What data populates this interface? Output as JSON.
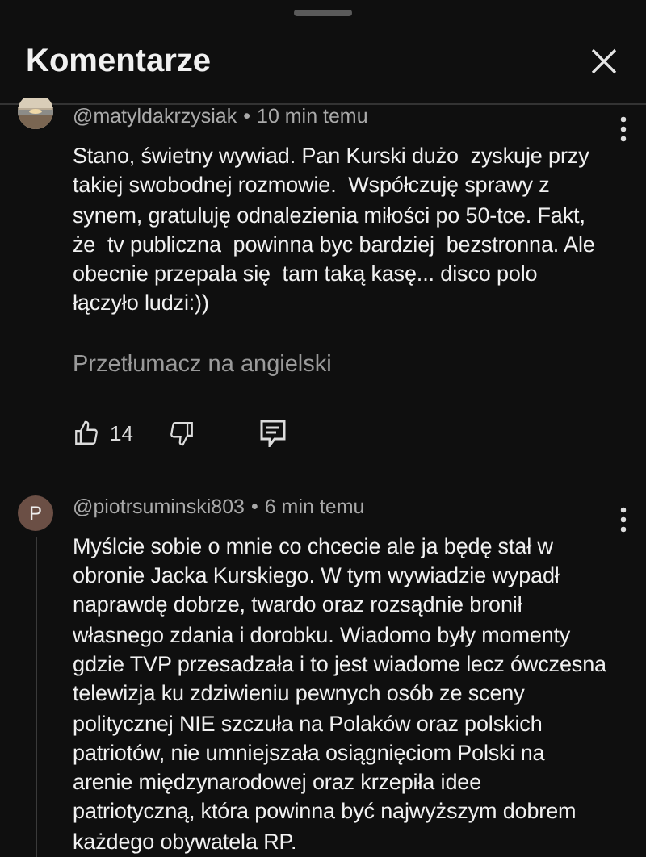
{
  "sheet": {
    "title": "Komentarze"
  },
  "comments": [
    {
      "author": "@matyldakrzysiak",
      "separator": "•",
      "time": "10 min temu",
      "text": "Stano, świetny wywiad. Pan Kurski dużo  zyskuje przy takiej swobodnej rozmowie.  Współczuję sprawy z synem, gratuluję odnalezienia miłości po 50-tce. Fakt, że  tv publiczna  powinna byc bardziej  bezstronna. Ale obecnie przepala się  tam taką kasę... disco polo łączyło ludzi:))",
      "translate": "Przetłumacz na angielski",
      "likes": "14"
    },
    {
      "avatar": {
        "kind": "letter",
        "letter": "P"
      },
      "author": "@piotrsuminski803",
      "separator": "•",
      "time": "6 min temu",
      "text": "Myślcie sobie o mnie co chcecie ale ja będę stał w obronie Jacka Kurskiego. W tym wywiadzie wypadł naprawdę dobrze, twardo oraz rozsądnie bronił własnego zdania i dorobku. Wiadomo były momenty gdzie TVP przesadzała i to jest wiadome lecz ówczesna telewizja ku zdziwieniu pewnych osób ze sceny politycznej NIE szczuła na Polaków oraz polskich patriotów, nie umniejszała osiągnięciom Polski na arenie międzynarodowej oraz krzepiła idee patriotyczną, która powinna być najwyższym dobrem każdego obywatela RP."
    }
  ]
}
